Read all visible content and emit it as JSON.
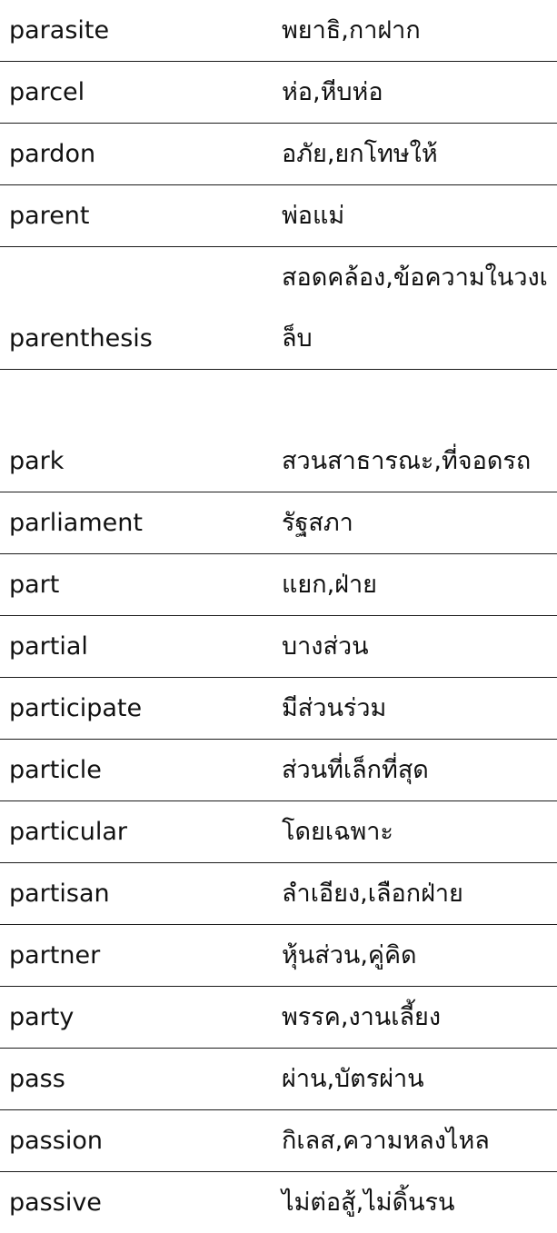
{
  "vocabulary": {
    "rows": [
      {
        "word": "parasite",
        "meaning": "พยาธิ,กาฝาก"
      },
      {
        "word": "parcel",
        "meaning": "ห่อ,หีบห่อ"
      },
      {
        "word": "pardon",
        "meaning": "อภัย,ยกโทษให้"
      },
      {
        "word": "parent",
        "meaning": "พ่อแม่"
      },
      {
        "word": "parenthesis",
        "meaning": "สอดคล้อง,ข้อความในวงเล็บ"
      },
      {
        "word": "park",
        "meaning": "สวนสาธารณะ,ที่จอดรถ"
      },
      {
        "word": "parliament",
        "meaning": "รัฐสภา"
      },
      {
        "word": "part",
        "meaning": "แยก,ฝ่าย"
      },
      {
        "word": "partial",
        "meaning": "บางส่วน"
      },
      {
        "word": "participate",
        "meaning": "มีส่วนร่วม"
      },
      {
        "word": "particle",
        "meaning": "ส่วนที่เล็กที่สุด"
      },
      {
        "word": "particular",
        "meaning": "โดยเฉพาะ"
      },
      {
        "word": "partisan",
        "meaning": "ลำเอียง,เลือกฝ่าย"
      },
      {
        "word": "partner",
        "meaning": "หุ้นส่วน,คู่คิด"
      },
      {
        "word": "party",
        "meaning": "พรรค,งานเลี้ยง"
      },
      {
        "word": "pass",
        "meaning": "ผ่าน,บัตรผ่าน"
      },
      {
        "word": "passion",
        "meaning": "กิเลส,ความหลงไหล"
      },
      {
        "word": "passive",
        "meaning": "ไม่ต่อสู้,ไม่ดิ้นรน"
      }
    ]
  }
}
